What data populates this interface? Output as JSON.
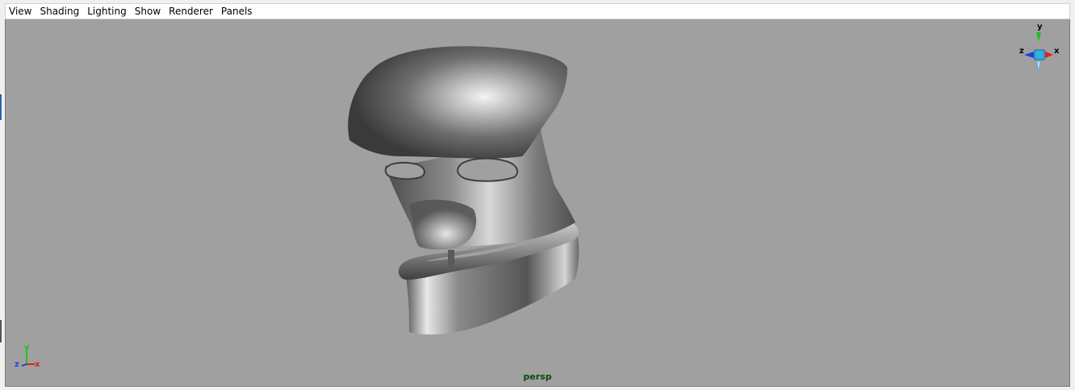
{
  "menu": {
    "items": [
      {
        "label": "View"
      },
      {
        "label": "Shading"
      },
      {
        "label": "Lighting"
      },
      {
        "label": "Show"
      },
      {
        "label": "Renderer"
      },
      {
        "label": "Panels"
      }
    ]
  },
  "viewport": {
    "camera_label": "persp",
    "background_color": "#a0a0a0",
    "object": "3D mask model (shaded grey surface)"
  },
  "view_cube": {
    "axes": {
      "y": "y",
      "x": "x",
      "z": "z"
    }
  },
  "origin_axis": {
    "axes": {
      "y": "y",
      "x": "x",
      "z": "z"
    }
  },
  "colors": {
    "x_axis": "#e02020",
    "y_axis": "#20c020",
    "z_axis": "#2040e0",
    "camera_label": "#0a4a0a"
  }
}
